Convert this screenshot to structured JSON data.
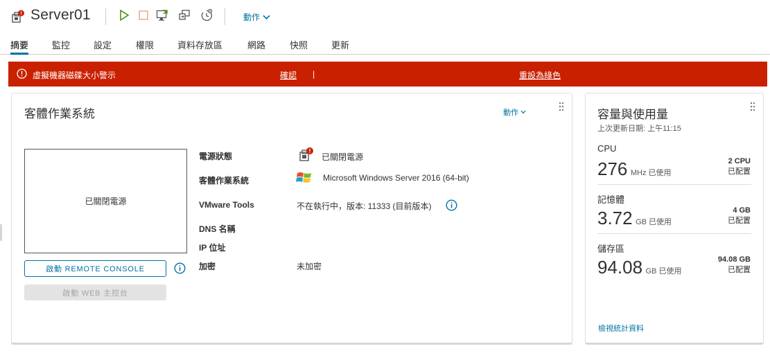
{
  "header": {
    "title": "Server01",
    "actions_label": "動作"
  },
  "tabs": [
    {
      "label": "摘要",
      "active": true
    },
    {
      "label": "監控"
    },
    {
      "label": "設定"
    },
    {
      "label": "權限"
    },
    {
      "label": "資料存放區"
    },
    {
      "label": "網路"
    },
    {
      "label": "快照"
    },
    {
      "label": "更新"
    }
  ],
  "alert": {
    "message": "虛擬機器磁碟大小警示",
    "acknowledge": "確認",
    "separator": "|",
    "reset": "重設為綠色",
    "color": "#c92100"
  },
  "guest_os": {
    "title": "客體作業系統",
    "actions_label": "動作",
    "preview_text": "已關閉電源",
    "remote_console_button": "啟動 REMOTE CONSOLE",
    "web_console_button": "啟動 WEB 主控台",
    "fields": [
      {
        "label": "電源狀態",
        "value": "已關閉電源"
      },
      {
        "label": "客體作業系統",
        "value": "Microsoft Windows Server 2016 (64-bit)"
      },
      {
        "label": "VMware Tools",
        "value": "不在執行中，版本: 11333 (目前版本)"
      },
      {
        "label": "DNS 名稱",
        "value": ""
      },
      {
        "label": "IP 位址",
        "value": ""
      },
      {
        "label": "加密",
        "value": "未加密"
      }
    ]
  },
  "capacity": {
    "title": "容量與使用量",
    "last_updated": "上次更新日期: 上午11:15",
    "items": [
      {
        "name": "CPU",
        "used": "276",
        "used_unit": "MHz 已使用",
        "allocated": "2 CPU",
        "allocated_label": "已配置"
      },
      {
        "name": "記憶體",
        "used": "3.72",
        "used_unit": "GB 已使用",
        "allocated": "4 GB",
        "allocated_label": "已配置"
      },
      {
        "name": "儲存區",
        "used": "94.08",
        "used_unit": "GB 已使用",
        "allocated": "94.08 GB",
        "allocated_label": "已配置"
      }
    ],
    "view_stats": "檢視統計資料"
  },
  "colors": {
    "accent": "#0072a3",
    "play": "#3c8500",
    "stop": "#f0a090",
    "alert_badge": "#c92100"
  }
}
